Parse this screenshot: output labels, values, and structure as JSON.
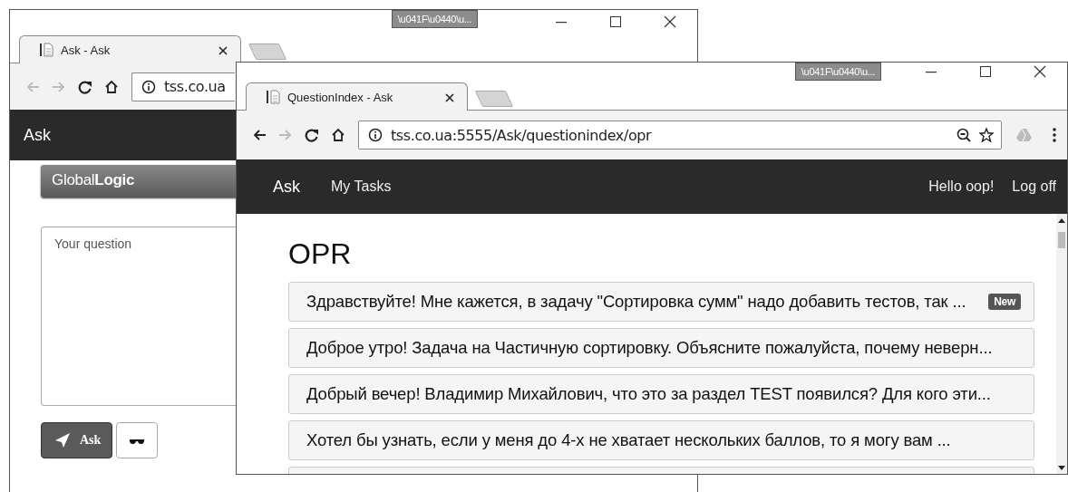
{
  "windows": [
    {
      "kind": "ask_form",
      "title_badge": "\\u041F\\u0440\\u...",
      "tab": {
        "title": "Ask - Ask",
        "selected": true
      },
      "toolbar": {
        "back_disabled": true,
        "forward_disabled": true,
        "address": "tss.co.ua"
      },
      "navbar": {
        "brand": "Ask"
      },
      "logo": "Global**Logic**",
      "question": {
        "placeholder": "Your question"
      },
      "ask_button": "Ask"
    },
    {
      "kind": "question_index",
      "title_badge": "\\u041F\\u0440\\u...",
      "tab": {
        "title": "QuestionIndex - Ask",
        "selected": true
      },
      "toolbar": {
        "back_disabled": false,
        "forward_disabled": true,
        "address": "tss.co.ua:5555/Ask/questionindex/opr"
      },
      "navbar": {
        "brand": "Ask",
        "links": [
          "My Tasks"
        ],
        "greeting": "Hello oop!",
        "logoff": "Log off"
      },
      "heading": "OPR",
      "questions": [
        {
          "text": "Здравствуйте! Мне кажется, в задачу \"Сортировка сумм\" надо добавить тестов, так ...",
          "badge": "New"
        },
        {
          "text": "Доброе утро! Задача на Частичную сортировку. Объясните пожалуйста, почему неверн..."
        },
        {
          "text": "Добрый вечер! Владимир Михайлович, что это за раздел TEST появился? Для кого эти..."
        },
        {
          "text": "Хотел бы узнать, если у меня до 4-х не хватает нескольких баллов, то я могу вам ..."
        }
      ]
    }
  ]
}
